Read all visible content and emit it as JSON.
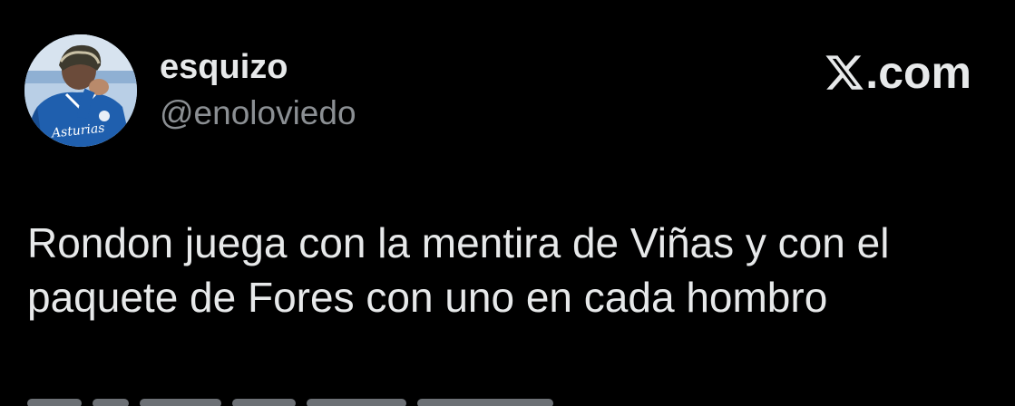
{
  "user": {
    "display_name": "esquizo",
    "handle": "@enoloviedo",
    "avatar_text": "Asturias"
  },
  "brand": {
    "text": ".com",
    "logo_icon": "x-logo-icon"
  },
  "tweet": {
    "lines": [
      "Rondon juega con la mentira de Viñas y con el",
      "paquete de Fores con uno en cada hombro"
    ]
  },
  "colors": {
    "background": "#000000",
    "primary_text": "#e7e9ea",
    "secondary_text": "#8b8f93"
  }
}
